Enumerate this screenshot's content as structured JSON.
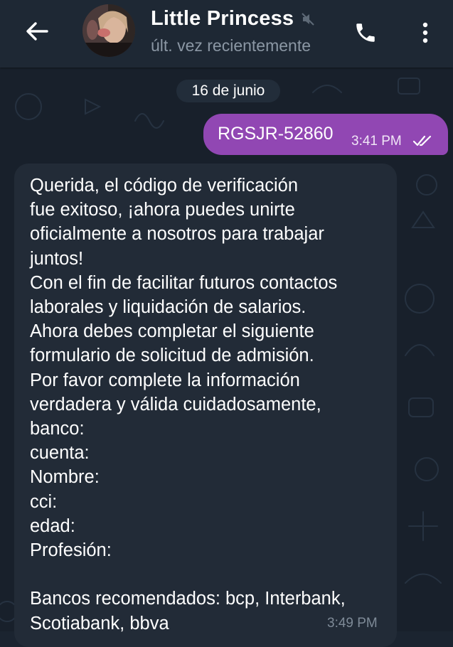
{
  "header": {
    "contact_name": "Little Princess",
    "status": "últ. vez recientemente",
    "icons": {
      "back": "arrow-left-icon",
      "mute": "muted-speaker-icon",
      "call": "phone-icon",
      "menu": "more-vertical-icon"
    }
  },
  "date_divider": "16 de junio",
  "messages": [
    {
      "direction": "outgoing",
      "text": "RGSJR-52860",
      "time": "3:41 PM",
      "status": "read"
    },
    {
      "direction": "incoming",
      "text": "Querida, el código de verificación\nfue exitoso, ¡ahora puedes unirte\noficialmente a nosotros para trabajar\njuntos!\nCon el fin de facilitar futuros contactos\nlaborales y liquidación de salarios.\nAhora debes completar el siguiente\nformulario de solicitud de admisión.\nPor favor complete la información\nverdadera y válida cuidadosamente,\nbanco:\ncuenta:\nNombre:\ncci:\nedad:\nProfesión:\n\nBancos recomendados: bcp, Interbank,\nScotiabank, bbva",
      "time": "3:49 PM"
    }
  ],
  "colors": {
    "header_bg": "#1e2834",
    "chat_bg": "#18202b",
    "outgoing_bubble": "#9147b3",
    "incoming_bubble": "#222b37",
    "secondary_text": "#8b97a4"
  }
}
